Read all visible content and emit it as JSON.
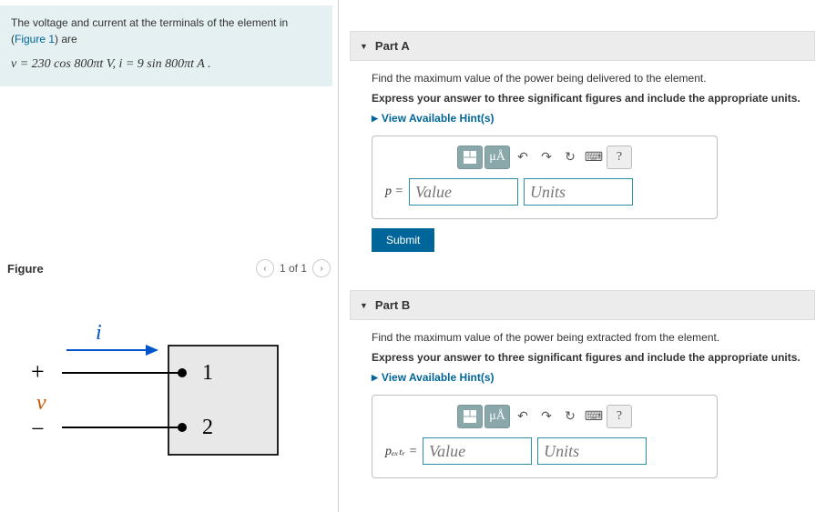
{
  "problem": {
    "intro_pre": "The voltage and current at the terminals of the element in (",
    "figure_link": "Figure 1",
    "intro_post": ") are",
    "eq": "v = 230 cos 800πt V,     i = 9 sin 800πt A ."
  },
  "figure": {
    "title": "Figure",
    "page": "1 of 1",
    "labels": {
      "current": "i",
      "plus": "+",
      "voltage": "v",
      "minus": "−",
      "t1": "1",
      "t2": "2"
    }
  },
  "partA": {
    "title": "Part A",
    "prompt": "Find the maximum value of the power being delivered to the element.",
    "instr": "Express your answer to three significant figures and include the appropriate units.",
    "hints": "View Available Hint(s)",
    "lhs": "p = ",
    "value_ph": "Value",
    "units_ph": "Units",
    "submit": "Submit",
    "ua_btn": "μÅ"
  },
  "partB": {
    "title": "Part B",
    "prompt": "Find the maximum value of the power being extracted from the element.",
    "instr": "Express your answer to three significant figures and include the appropriate units.",
    "hints": "View Available Hint(s)",
    "lhs": "pₑₓₜᵣ = ",
    "value_ph": "Value",
    "units_ph": "Units",
    "ua_btn": "μÅ"
  }
}
